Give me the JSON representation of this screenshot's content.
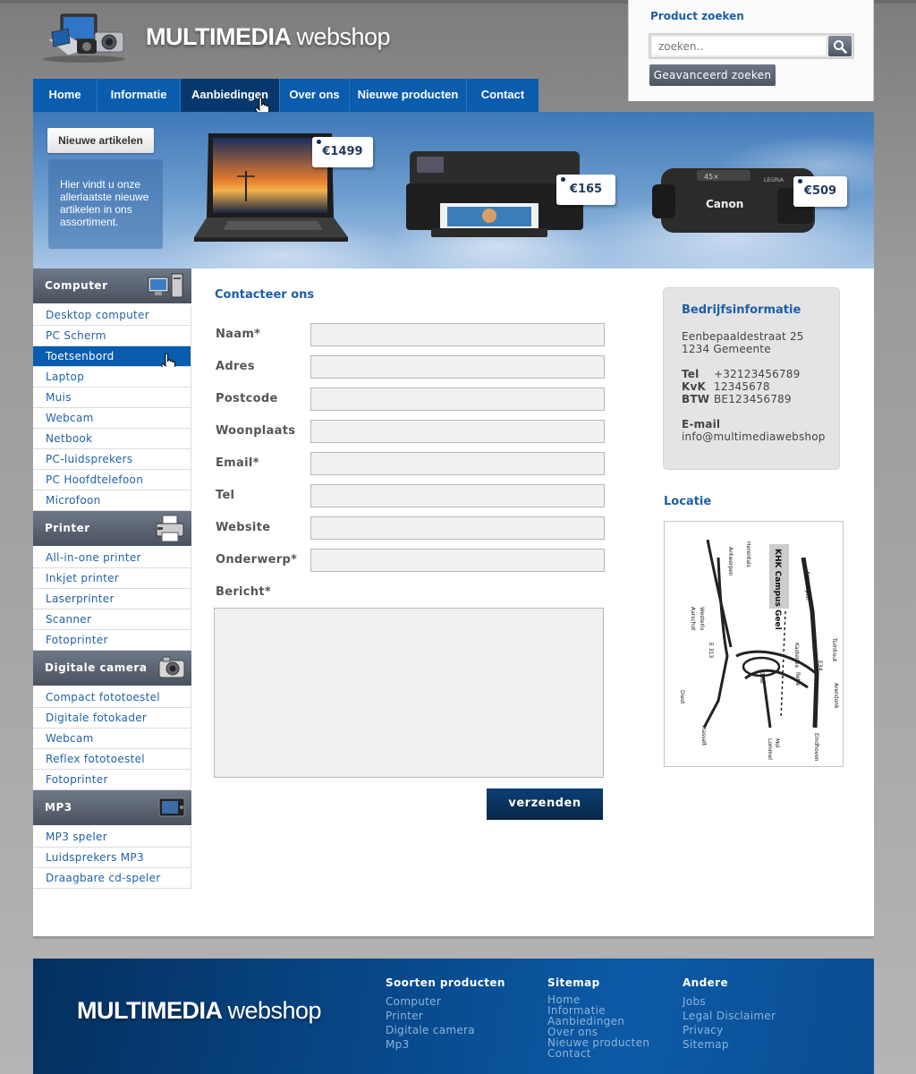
{
  "header": {
    "logo_bold": "MULTIMEDIA",
    "logo_light": "webshop"
  },
  "search": {
    "title": "Product zoeken",
    "placeholder": "zoeken..",
    "advanced_label": "Geavanceerd zoeken"
  },
  "nav": {
    "items": [
      {
        "label": "Home"
      },
      {
        "label": "Informatie"
      },
      {
        "label": "Aanbiedingen"
      },
      {
        "label": "Over ons"
      },
      {
        "label": "Nieuwe producten"
      },
      {
        "label": "Contact"
      }
    ],
    "active": "Aanbiedingen"
  },
  "banner": {
    "button_label": "Nieuwe artikelen",
    "text": "Hier vindt u onze allerlaatste nieuwe artikelen in ons assortiment.",
    "prices": [
      "€1499",
      "€165",
      "€509"
    ]
  },
  "sidebar": {
    "categories": [
      {
        "title": "Computer",
        "icon": "computer-icon",
        "items": [
          "Desktop computer",
          "PC Scherm",
          "Toetsenbord",
          "Laptop",
          "Muis",
          "Webcam",
          "Netbook",
          "PC-luidsprekers",
          "PC Hoofdtelefoon",
          "Microfoon"
        ]
      },
      {
        "title": "Printer",
        "icon": "printer-icon",
        "items": [
          "All-in-one printer",
          "Inkjet printer",
          "Laserprinter",
          "Scanner",
          "Fotoprinter"
        ]
      },
      {
        "title": "Digitale camera",
        "icon": "camera-icon",
        "items": [
          "Compact fototoestel",
          "Digitale fotokader",
          "Webcam",
          "Reflex fototoestel",
          "Fotoprinter"
        ]
      },
      {
        "title": "MP3",
        "icon": "mp3-player-icon",
        "items": [
          "MP3 speler",
          "Luidsprekers MP3",
          "Draagbare cd-speler"
        ]
      }
    ],
    "active_item": "Toetsenbord"
  },
  "form": {
    "title": "Contacteer ons",
    "fields": {
      "naam": "Naam*",
      "adres": "Adres",
      "postcode": "Postcode",
      "woonplaats": "Woonplaats",
      "email": "Email*",
      "tel": "Tel",
      "website": "Website",
      "onderwerp": "Onderwerp*",
      "bericht": "Bericht*"
    },
    "submit_label": "verzenden"
  },
  "company": {
    "title": "Bedrijfsinformatie",
    "street": "Eenbepaaldestraat 25",
    "city": "1234 Gemeente",
    "tel_label": "Tel",
    "tel": "+32123456789",
    "kvk_label": "KvK",
    "kvk": "12345678",
    "btw_label": "BTW",
    "btw": "BE123456789",
    "email_label": "E-mail",
    "email": "info@multimediawebshop"
  },
  "location": {
    "title": "Locatie",
    "map_labels": {
      "campus": "KHK Campus Geel",
      "antwerpen": "Antwerpen",
      "herentals": "Herentals",
      "turnhout": "Turnhout",
      "westerlo": "Westerlo",
      "aarschot": "Aarschot",
      "e313": "E 313",
      "e34": "E34",
      "kasterlee": "Kasterlee",
      "retie": "Retie",
      "geel": "Geel",
      "arendonk": "Arendonk",
      "diest": "Diest",
      "hasselt": "Hasselt",
      "mol": "Mol",
      "lommel": "Lommel",
      "eindhoven": "Eindhoven"
    }
  },
  "footer": {
    "logo_bold": "MULTIMEDIA",
    "logo_light": "webshop",
    "columns": [
      {
        "title": "Soorten producten",
        "links": [
          "Computer",
          "Printer",
          "Digitale camera",
          "Mp3"
        ]
      },
      {
        "title": "Sitemap",
        "links": [
          "Home",
          "Informatie",
          "Aanbiedingen",
          "Over ons",
          "Nieuwe producten",
          "Contact"
        ]
      },
      {
        "title": "Andere",
        "links": [
          "Jobs",
          "Legal Disclaimer",
          "Privacy",
          "Sitemap"
        ]
      }
    ]
  }
}
